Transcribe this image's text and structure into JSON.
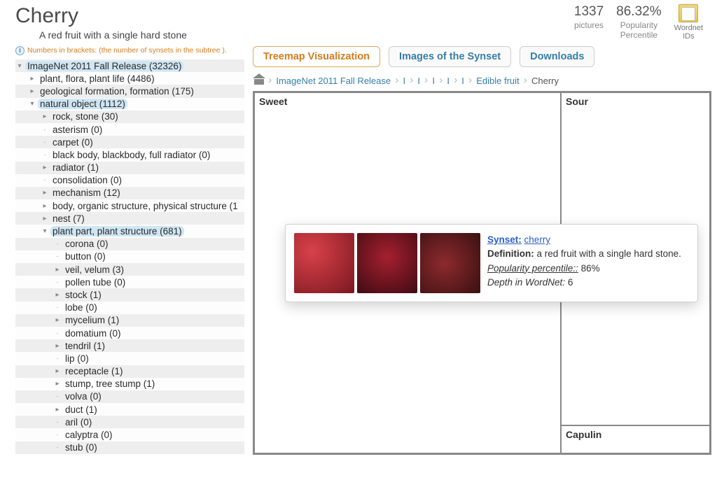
{
  "header": {
    "title": "Cherry",
    "subtitle": "A red fruit with a single hard stone",
    "stats": {
      "pictures_value": "1337",
      "pictures_label": "pictures",
      "percentile_value": "86.32%",
      "percentile_label1": "Popularity",
      "percentile_label2": "Percentile"
    },
    "wordnet_label1": "Wordnet",
    "wordnet_label2": "IDs"
  },
  "sidebar": {
    "hint": "Numbers in brackets: (the number of synsets in the subtree ).",
    "tree": [
      {
        "d": 0,
        "t": "-",
        "hl": true,
        "label": "ImageNet 2011 Fall Release (32326)"
      },
      {
        "d": 1,
        "t": "+",
        "hl": false,
        "label": "plant, flora, plant life (4486)"
      },
      {
        "d": 1,
        "t": "+",
        "hl": false,
        "label": "geological formation, formation (175)"
      },
      {
        "d": 1,
        "t": "-",
        "hl": true,
        "label": "natural object (1112)"
      },
      {
        "d": 2,
        "t": "+",
        "hl": false,
        "label": "rock, stone (30)"
      },
      {
        "d": 2,
        "t": "·",
        "hl": false,
        "label": "asterism (0)"
      },
      {
        "d": 2,
        "t": "·",
        "hl": false,
        "label": "carpet (0)"
      },
      {
        "d": 2,
        "t": "·",
        "hl": false,
        "label": "black body, blackbody, full radiator (0)"
      },
      {
        "d": 2,
        "t": "+",
        "hl": false,
        "label": "radiator (1)"
      },
      {
        "d": 2,
        "t": "·",
        "hl": false,
        "label": "consolidation (0)"
      },
      {
        "d": 2,
        "t": "+",
        "hl": false,
        "label": "mechanism (12)"
      },
      {
        "d": 2,
        "t": "+",
        "hl": false,
        "label": "body, organic structure, physical structure (1"
      },
      {
        "d": 2,
        "t": "+",
        "hl": false,
        "label": "nest (7)"
      },
      {
        "d": 2,
        "t": "-",
        "hl": true,
        "label": "plant part, plant structure (681)"
      },
      {
        "d": 3,
        "t": "·",
        "hl": false,
        "label": "corona (0)"
      },
      {
        "d": 3,
        "t": "·",
        "hl": false,
        "label": "button (0)"
      },
      {
        "d": 3,
        "t": "+",
        "hl": false,
        "label": "veil, velum (3)"
      },
      {
        "d": 3,
        "t": "·",
        "hl": false,
        "label": "pollen tube (0)"
      },
      {
        "d": 3,
        "t": "+",
        "hl": false,
        "label": "stock (1)"
      },
      {
        "d": 3,
        "t": "·",
        "hl": false,
        "label": "lobe (0)"
      },
      {
        "d": 3,
        "t": "+",
        "hl": false,
        "label": "mycelium (1)"
      },
      {
        "d": 3,
        "t": "·",
        "hl": false,
        "label": "domatium (0)"
      },
      {
        "d": 3,
        "t": "+",
        "hl": false,
        "label": "tendril (1)"
      },
      {
        "d": 3,
        "t": "·",
        "hl": false,
        "label": "lip (0)"
      },
      {
        "d": 3,
        "t": "+",
        "hl": false,
        "label": "receptacle (1)"
      },
      {
        "d": 3,
        "t": "+",
        "hl": false,
        "label": "stump, tree stump (1)"
      },
      {
        "d": 3,
        "t": "·",
        "hl": false,
        "label": "volva (0)"
      },
      {
        "d": 3,
        "t": "+",
        "hl": false,
        "label": "duct (1)"
      },
      {
        "d": 3,
        "t": "·",
        "hl": false,
        "label": "aril (0)"
      },
      {
        "d": 3,
        "t": "·",
        "hl": false,
        "label": "calyptra (0)"
      },
      {
        "d": 3,
        "t": "·",
        "hl": false,
        "label": "stub (0)"
      }
    ]
  },
  "tabs": {
    "treemap": "Treemap Visualization",
    "images": "Images of the Synset",
    "downloads": "Downloads"
  },
  "breadcrumbs": {
    "items": [
      "ImageNet 2011 Fall Release",
      "I",
      "I",
      "I",
      "I",
      "I",
      "Edible fruit",
      "Cherry"
    ]
  },
  "treemap": {
    "sweet": "Sweet",
    "sour": "Sour",
    "capulin": "Capulin"
  },
  "tooltip": {
    "synset_label": "Synset:",
    "synset_value": "cherry",
    "definition_label": "Definition:",
    "definition_value": "a red fruit with a single hard stone.",
    "percentile_label": "Popularity percentile::",
    "percentile_value": "86%",
    "depth_label": "Depth in WordNet:",
    "depth_value": "6"
  }
}
